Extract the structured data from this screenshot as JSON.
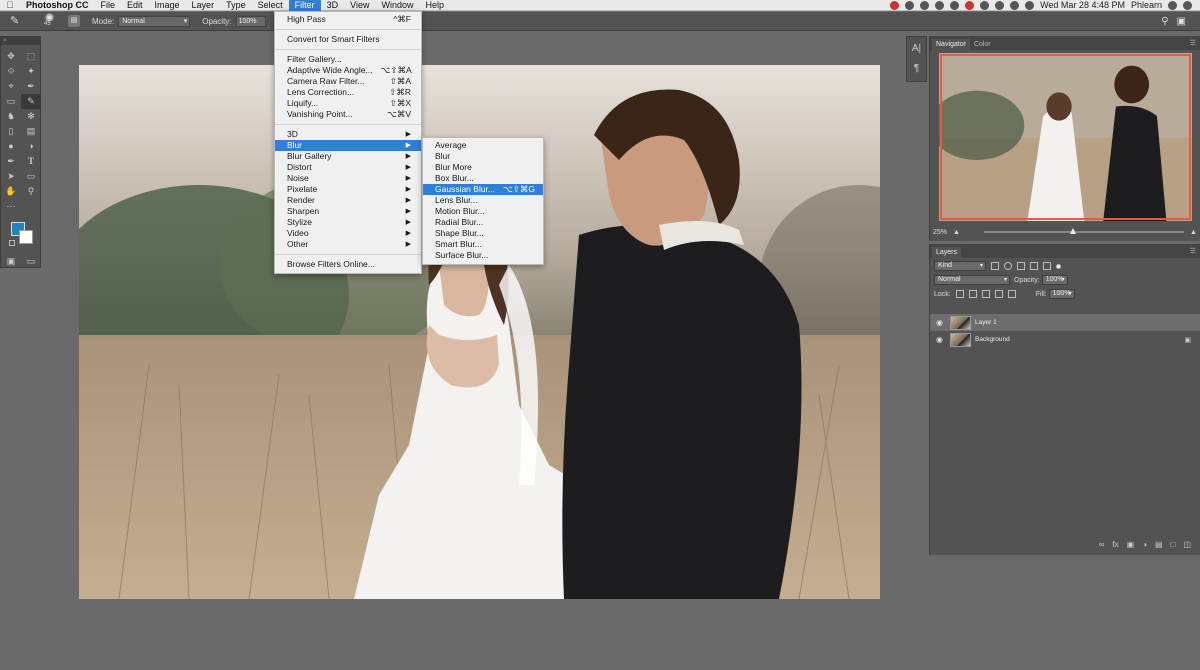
{
  "menubar": {
    "app_name": "Photoshop CC",
    "items": [
      "File",
      "Edit",
      "Image",
      "Layer",
      "Type",
      "Select",
      "Filter",
      "3D",
      "View",
      "Window",
      "Help"
    ],
    "active_item": "Filter",
    "datetime": "Wed Mar 28  4:48 PM",
    "user": "Phlearn"
  },
  "options_bar": {
    "brush_size": "45",
    "mode_label": "Mode:",
    "mode_value": "Normal",
    "opacity_label": "Opacity:",
    "opacity_value": "100%"
  },
  "filter_menu": {
    "groups": [
      [
        {
          "label": "High Pass",
          "shortcut": "^⌘F",
          "highlighted": false
        }
      ],
      [
        {
          "label": "Convert for Smart Filters",
          "shortcut": ""
        }
      ],
      [
        {
          "label": "Filter Gallery...",
          "shortcut": ""
        },
        {
          "label": "Adaptive Wide Angle...",
          "shortcut": "⌥⇧⌘A"
        },
        {
          "label": "Camera Raw Filter...",
          "shortcut": "⇧⌘A"
        },
        {
          "label": "Lens Correction...",
          "shortcut": "⇧⌘R"
        },
        {
          "label": "Liquify...",
          "shortcut": "⇧⌘X"
        },
        {
          "label": "Vanishing Point...",
          "shortcut": "⌥⌘V"
        }
      ],
      [
        {
          "label": "3D",
          "submenu": true
        },
        {
          "label": "Blur",
          "submenu": true,
          "highlighted": true
        },
        {
          "label": "Blur Gallery",
          "submenu": true
        },
        {
          "label": "Distort",
          "submenu": true
        },
        {
          "label": "Noise",
          "submenu": true
        },
        {
          "label": "Pixelate",
          "submenu": true
        },
        {
          "label": "Render",
          "submenu": true
        },
        {
          "label": "Sharpen",
          "submenu": true
        },
        {
          "label": "Stylize",
          "submenu": true
        },
        {
          "label": "Video",
          "submenu": true
        },
        {
          "label": "Other",
          "submenu": true
        }
      ],
      [
        {
          "label": "Browse Filters Online...",
          "shortcut": ""
        }
      ]
    ]
  },
  "blur_menu": {
    "items": [
      {
        "label": "Average",
        "shortcut": ""
      },
      {
        "label": "Blur",
        "shortcut": ""
      },
      {
        "label": "Blur More",
        "shortcut": ""
      },
      {
        "label": "Box Blur...",
        "shortcut": ""
      },
      {
        "label": "Gaussian Blur...",
        "shortcut": "⌥⇧⌘G",
        "highlighted": true
      },
      {
        "label": "Lens Blur...",
        "shortcut": ""
      },
      {
        "label": "Motion Blur...",
        "shortcut": ""
      },
      {
        "label": "Radial Blur...",
        "shortcut": ""
      },
      {
        "label": "Shape Blur...",
        "shortcut": ""
      },
      {
        "label": "Smart Blur...",
        "shortcut": ""
      },
      {
        "label": "Surface Blur...",
        "shortcut": ""
      }
    ]
  },
  "navigator": {
    "tabs": [
      "Navigator",
      "Color"
    ],
    "zoom": "25%"
  },
  "layers": {
    "tab": "Layers",
    "filter_kind": "Kind",
    "blend_mode": "Normal",
    "opacity_label": "Opacity:",
    "opacity_value": "100%",
    "lock_label": "Lock:",
    "fill_label": "Fill:",
    "fill_value": "100%",
    "items": [
      {
        "name": "Layer 1",
        "selected": true
      },
      {
        "name": "Background",
        "locked": true
      }
    ]
  },
  "colors": {
    "menu_highlight": "#2f7fd7",
    "foreground_swatch": "#1d84bd",
    "background_swatch": "#ffffff",
    "navigator_proxy": "#e45a45"
  }
}
